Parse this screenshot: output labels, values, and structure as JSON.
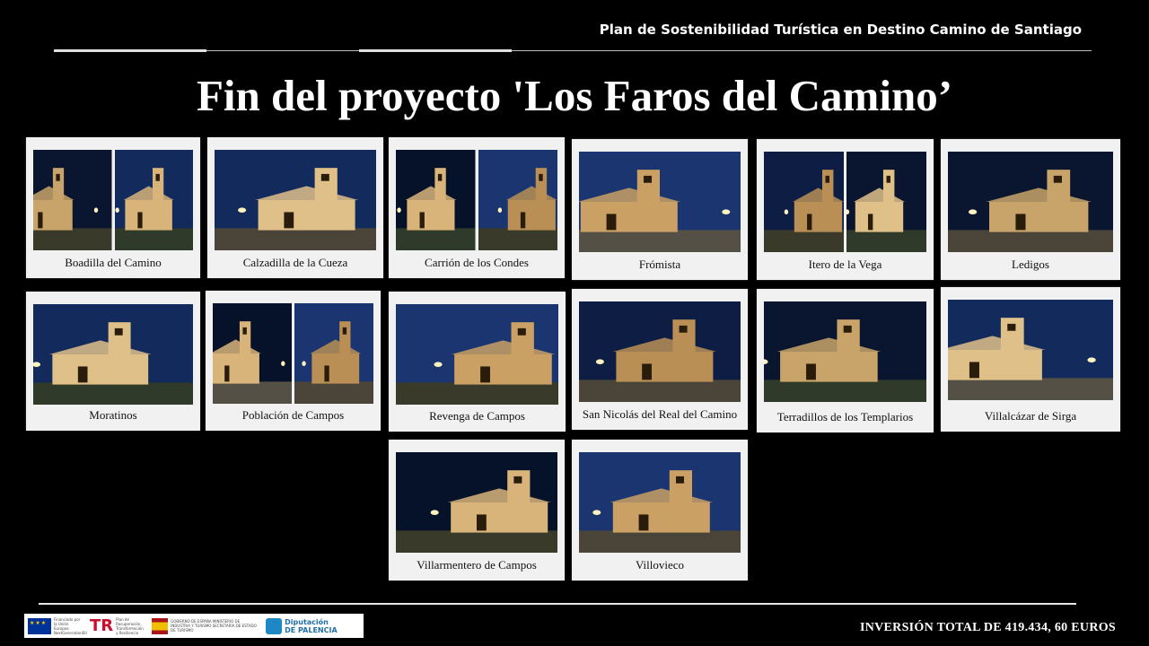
{
  "header": {
    "program_title": "Plan de Sostenibilidad Turística en Destino Camino de Santiago"
  },
  "title": "Fin del proyecto 'Los Faros del Camino’",
  "cards": [
    {
      "label": "Boadilla del Camino",
      "photos": 2
    },
    {
      "label": "Calzadilla de la Cueza",
      "photos": 1
    },
    {
      "label": "Carrión de los Condes",
      "photos": 2
    },
    {
      "label": "Frómista",
      "photos": 1
    },
    {
      "label": "Itero de la Vega",
      "photos": 2
    },
    {
      "label": "Ledigos",
      "photos": 1
    },
    {
      "label": "Moratinos",
      "photos": 1
    },
    {
      "label": "Población de Campos",
      "photos": 2
    },
    {
      "label": "Revenga de Campos",
      "photos": 1
    },
    {
      "label": "San Nicolás del Real del Camino",
      "photos": 1
    },
    {
      "label": "Terradillos de los Templarios",
      "photos": 1
    },
    {
      "label": "Villalcázar de Sirga",
      "photos": 1
    },
    {
      "label": "Villarmentero de Campos",
      "photos": 1
    },
    {
      "label": "Villovieco",
      "photos": 1
    }
  ],
  "footer": {
    "investment": "INVERSIÓN TOTAL DE 419.434, 60 EUROS",
    "logos": [
      {
        "icon": "eu-flag-icon",
        "text": "Financiado por la Unión Europea NextGenerationEU"
      },
      {
        "icon": "recovery-plan-icon",
        "mark": "TR",
        "text": "Plan de Recuperación, Transformación y Resiliencia"
      },
      {
        "icon": "spain-government-icon",
        "text": "GOBIERNO DE ESPAÑA MINISTERIO DE INDUSTRIA Y TURISMO SECRETARÍA DE ESTADO DE TURISMO"
      },
      {
        "icon": "diputacion-icon",
        "text": "Diputación DE PALENCIA"
      }
    ]
  },
  "colors": {
    "background": "#000000",
    "card": "#f1f1f1",
    "night_sky": "#0b1a3a",
    "building": "#c9a46a"
  }
}
